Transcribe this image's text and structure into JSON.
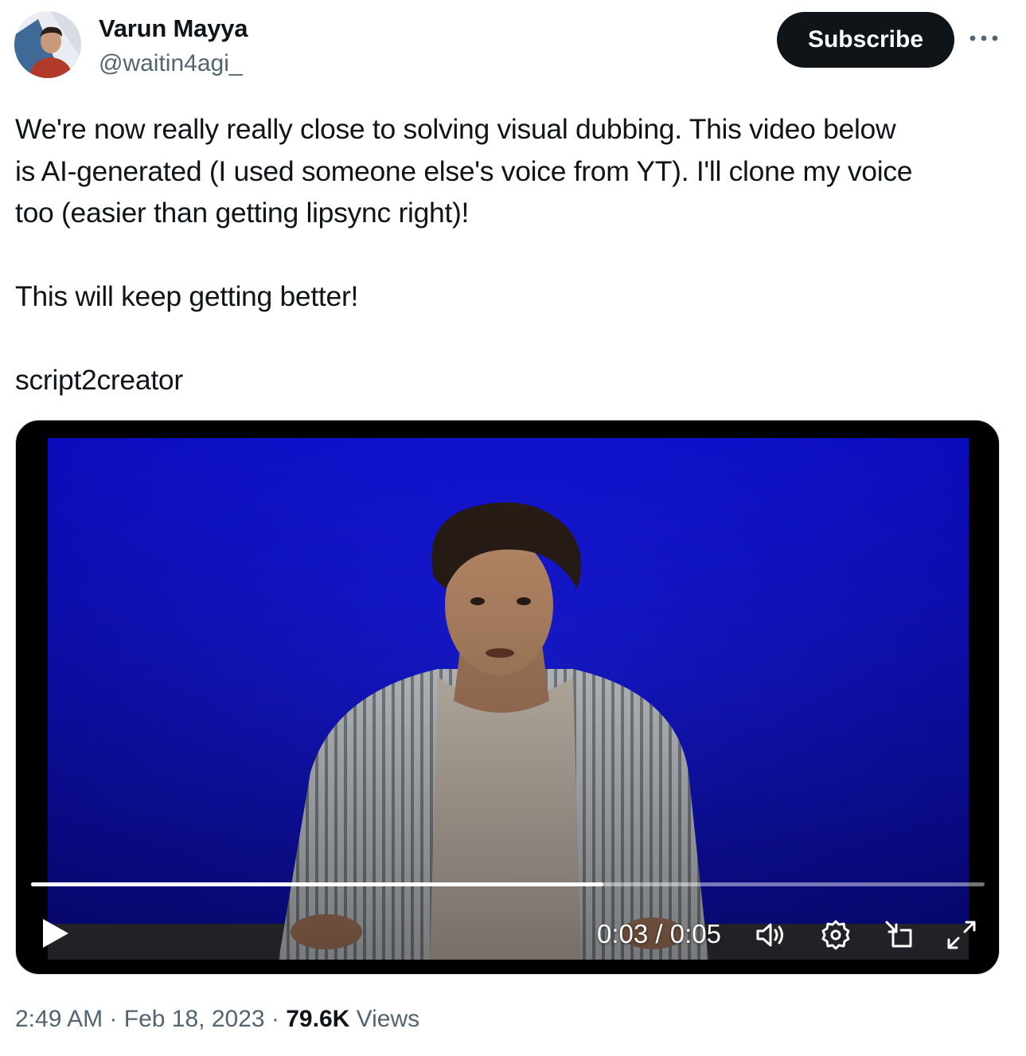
{
  "author": {
    "name": "Varun Mayya",
    "handle": "@waitin4agi_"
  },
  "header": {
    "subscribe_label": "Subscribe",
    "more_icon": "more-horizontal-icon"
  },
  "tweet": {
    "lines": [
      "We're now really really close to solving visual dubbing. This video below",
      "is AI-generated (I used someone else's voice from YT). I'll clone my voice",
      "too (easier than getting lipsync right)!",
      "This will keep getting better!",
      "script2creator"
    ]
  },
  "video": {
    "background_color": "#1010d6",
    "progress": 0.6,
    "time_current": "0:03",
    "time_separator": " / ",
    "time_total": "0:05",
    "icons": [
      "play-icon",
      "volume-icon",
      "settings-icon",
      "picture-in-picture-icon",
      "fullscreen-icon"
    ]
  },
  "meta": {
    "time": "2:49 AM",
    "separator": " · ",
    "date": "Feb 18, 2023",
    "views_count": "79.6K",
    "views_label": "Views"
  }
}
